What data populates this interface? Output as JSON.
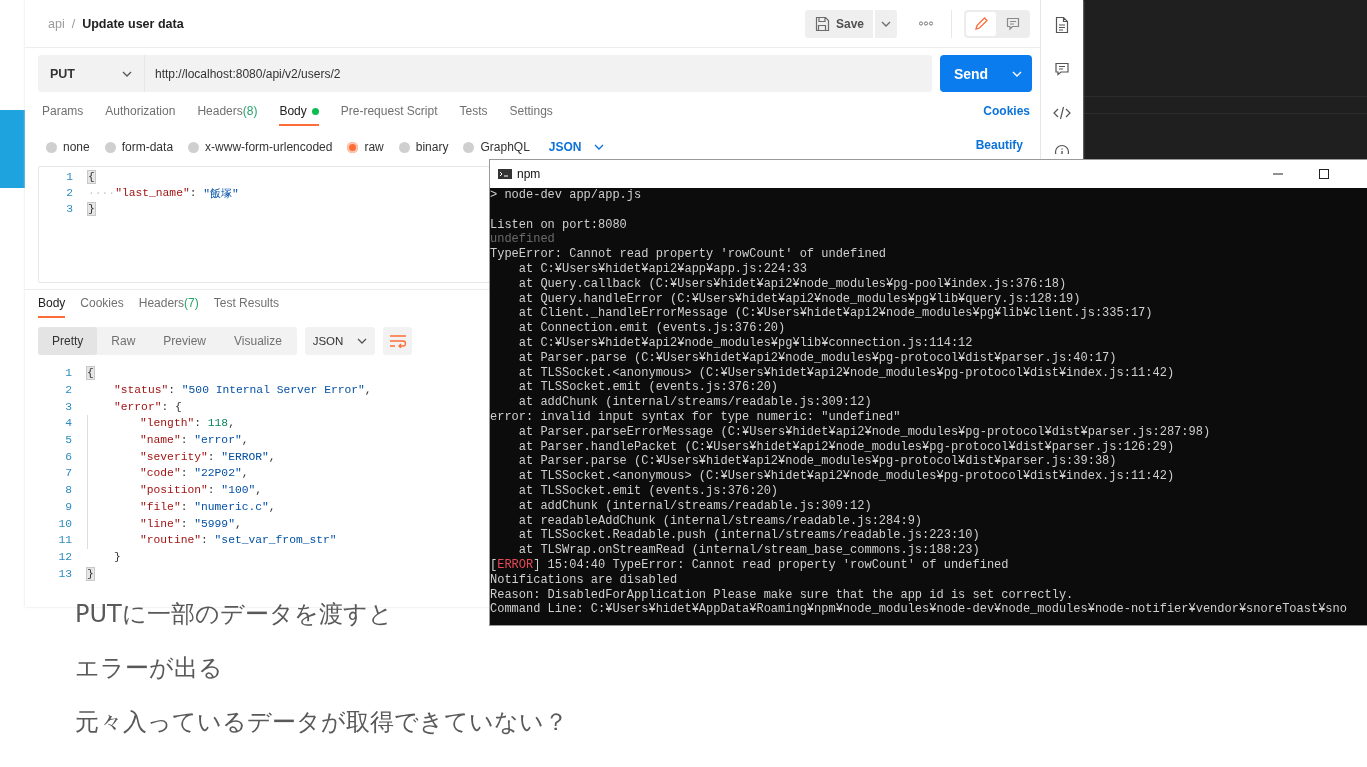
{
  "postman": {
    "breadcrumb": {
      "parent": "api",
      "separator": "/",
      "title": "Update user data"
    },
    "save": "Save",
    "mode_toggle": [
      {
        "selected": true
      },
      {
        "selected": false
      }
    ],
    "method": "PUT",
    "url": "http://localhost:8080/api/v2/users/2",
    "send": "Send",
    "request_tabs": [
      {
        "label": "Params",
        "selected": false
      },
      {
        "label": "Authorization",
        "selected": false
      },
      {
        "label": "Headers",
        "count": "(8)",
        "selected": false
      },
      {
        "label": "Body",
        "selected": true,
        "dot": true
      },
      {
        "label": "Pre-request Script",
        "selected": false
      },
      {
        "label": "Tests",
        "selected": false
      },
      {
        "label": "Settings",
        "selected": false
      }
    ],
    "cookies_link": "Cookies",
    "body_types": [
      {
        "label": "none",
        "selected": false
      },
      {
        "label": "form-data",
        "selected": false
      },
      {
        "label": "x-www-form-urlencoded",
        "selected": false
      },
      {
        "label": "raw",
        "selected": true
      },
      {
        "label": "binary",
        "selected": false
      },
      {
        "label": "GraphQL",
        "selected": false
      }
    ],
    "body_format": "JSON",
    "beautify": "Beautify",
    "request_body": [
      {
        "no": "1",
        "kind": "root",
        "tokens": [
          {
            "kind": "brace",
            "text": "{"
          }
        ]
      },
      {
        "no": "2",
        "kind": "root",
        "tokens": [
          {
            "kind": "ws",
            "text": "····"
          },
          {
            "kind": "key",
            "text": "\"last_name\""
          },
          {
            "kind": "punct",
            "text": ": "
          },
          {
            "kind": "string",
            "text": "\"飯塚\""
          }
        ]
      },
      {
        "no": "3",
        "kind": "root",
        "tokens": [
          {
            "kind": "brace",
            "text": "}"
          }
        ]
      }
    ],
    "response_tabs": [
      {
        "label": "Body",
        "selected": true
      },
      {
        "label": "Cookies",
        "selected": false
      },
      {
        "label": "Headers",
        "count": "(7)",
        "selected": false
      },
      {
        "label": "Test Results",
        "selected": false
      }
    ],
    "view_modes": [
      {
        "label": "Pretty",
        "selected": true
      },
      {
        "label": "Raw",
        "selected": false
      },
      {
        "label": "Preview",
        "selected": false
      },
      {
        "label": "Visualize",
        "selected": false
      }
    ],
    "response_format": "JSON",
    "response_body": [
      {
        "no": "1",
        "kind": "root",
        "tokens": [
          {
            "kind": "brace",
            "text": "{"
          }
        ]
      },
      {
        "no": "2",
        "kind": "member",
        "tokens": [
          {
            "kind": "key",
            "text": "\"status\""
          },
          {
            "kind": "punct",
            "text": ": "
          },
          {
            "kind": "string",
            "text": "\"500 Internal Server Error\""
          },
          {
            "kind": "punct",
            "text": ","
          }
        ]
      },
      {
        "no": "3",
        "kind": "member",
        "tokens": [
          {
            "kind": "key",
            "text": "\"error\""
          },
          {
            "kind": "punct",
            "text": ": {"
          }
        ]
      },
      {
        "no": "4",
        "kind": "inner",
        "tokens": [
          {
            "kind": "key",
            "text": "\"length\""
          },
          {
            "kind": "punct",
            "text": ": "
          },
          {
            "kind": "number",
            "text": "118"
          },
          {
            "kind": "punct",
            "text": ","
          }
        ]
      },
      {
        "no": "5",
        "kind": "inner",
        "tokens": [
          {
            "kind": "key",
            "text": "\"name\""
          },
          {
            "kind": "punct",
            "text": ": "
          },
          {
            "kind": "string",
            "text": "\"error\""
          },
          {
            "kind": "punct",
            "text": ","
          }
        ]
      },
      {
        "no": "6",
        "kind": "inner",
        "tokens": [
          {
            "kind": "key",
            "text": "\"severity\""
          },
          {
            "kind": "punct",
            "text": ": "
          },
          {
            "kind": "string",
            "text": "\"ERROR\""
          },
          {
            "kind": "punct",
            "text": ","
          }
        ]
      },
      {
        "no": "7",
        "kind": "inner",
        "tokens": [
          {
            "kind": "key",
            "text": "\"code\""
          },
          {
            "kind": "punct",
            "text": ": "
          },
          {
            "kind": "string",
            "text": "\"22P02\""
          },
          {
            "kind": "punct",
            "text": ","
          }
        ]
      },
      {
        "no": "8",
        "kind": "inner",
        "tokens": [
          {
            "kind": "key",
            "text": "\"position\""
          },
          {
            "kind": "punct",
            "text": ": "
          },
          {
            "kind": "string",
            "text": "\"100\""
          },
          {
            "kind": "punct",
            "text": ","
          }
        ]
      },
      {
        "no": "9",
        "kind": "inner",
        "tokens": [
          {
            "kind": "key",
            "text": "\"file\""
          },
          {
            "kind": "punct",
            "text": ": "
          },
          {
            "kind": "string",
            "text": "\"numeric.c\""
          },
          {
            "kind": "punct",
            "text": ","
          }
        ]
      },
      {
        "no": "10",
        "kind": "inner",
        "tokens": [
          {
            "kind": "key",
            "text": "\"line\""
          },
          {
            "kind": "punct",
            "text": ": "
          },
          {
            "kind": "string",
            "text": "\"5999\""
          },
          {
            "kind": "punct",
            "text": ","
          }
        ]
      },
      {
        "no": "11",
        "kind": "inner",
        "tokens": [
          {
            "kind": "key",
            "text": "\"routine\""
          },
          {
            "kind": "punct",
            "text": ": "
          },
          {
            "kind": "string",
            "text": "\"set_var_from_str\""
          }
        ]
      },
      {
        "no": "12",
        "kind": "member",
        "tokens": [
          {
            "kind": "punct",
            "text": "}"
          }
        ]
      },
      {
        "no": "13",
        "kind": "root",
        "tokens": [
          {
            "kind": "brace",
            "text": "}"
          }
        ]
      }
    ]
  },
  "terminal": {
    "title": "npm",
    "lines": [
      {
        "kind": "normal",
        "text": "> node-dev app/app.js"
      },
      {
        "kind": "blank"
      },
      {
        "kind": "normal",
        "text": "Listen on port:8080"
      },
      {
        "kind": "dim",
        "text": "undefined"
      },
      {
        "kind": "normal",
        "text": "TypeError: Cannot read property 'rowCount' of undefined"
      },
      {
        "kind": "normal",
        "text": "    at C:¥Users¥hidet¥api2¥app¥app.js:224:33"
      },
      {
        "kind": "normal",
        "text": "    at Query.callback (C:¥Users¥hidet¥api2¥node_modules¥pg-pool¥index.js:376:18)"
      },
      {
        "kind": "normal",
        "text": "    at Query.handleError (C:¥Users¥hidet¥api2¥node_modules¥pg¥lib¥query.js:128:19)"
      },
      {
        "kind": "normal",
        "text": "    at Client._handleErrorMessage (C:¥Users¥hidet¥api2¥node_modules¥pg¥lib¥client.js:335:17)"
      },
      {
        "kind": "normal",
        "text": "    at Connection.emit (events.js:376:20)"
      },
      {
        "kind": "normal",
        "text": "    at C:¥Users¥hidet¥api2¥node_modules¥pg¥lib¥connection.js:114:12"
      },
      {
        "kind": "normal",
        "text": "    at Parser.parse (C:¥Users¥hidet¥api2¥node_modules¥pg-protocol¥dist¥parser.js:40:17)"
      },
      {
        "kind": "normal",
        "text": "    at TLSSocket.<anonymous> (C:¥Users¥hidet¥api2¥node_modules¥pg-protocol¥dist¥index.js:11:42)"
      },
      {
        "kind": "normal",
        "text": "    at TLSSocket.emit (events.js:376:20)"
      },
      {
        "kind": "normal",
        "text": "    at addChunk (internal/streams/readable.js:309:12)"
      },
      {
        "kind": "normal",
        "text": "error: invalid input syntax for type numeric: \"undefined\""
      },
      {
        "kind": "normal",
        "text": "    at Parser.parseErrorMessage (C:¥Users¥hidet¥api2¥node_modules¥pg-protocol¥dist¥parser.js:287:98)"
      },
      {
        "kind": "normal",
        "text": "    at Parser.handlePacket (C:¥Users¥hidet¥api2¥node_modules¥pg-protocol¥dist¥parser.js:126:29)"
      },
      {
        "kind": "normal",
        "text": "    at Parser.parse (C:¥Users¥hidet¥api2¥node_modules¥pg-protocol¥dist¥parser.js:39:38)"
      },
      {
        "kind": "normal",
        "text": "    at TLSSocket.<anonymous> (C:¥Users¥hidet¥api2¥node_modules¥pg-protocol¥dist¥index.js:11:42)"
      },
      {
        "kind": "normal",
        "text": "    at TLSSocket.emit (events.js:376:20)"
      },
      {
        "kind": "normal",
        "text": "    at addChunk (internal/streams/readable.js:309:12)"
      },
      {
        "kind": "normal",
        "text": "    at readableAddChunk (internal/streams/readable.js:284:9)"
      },
      {
        "kind": "normal",
        "text": "    at TLSSocket.Readable.push (internal/streams/readable.js:223:10)"
      },
      {
        "kind": "normal",
        "text": "    at TLSWrap.onStreamRead (internal/stream_base_commons.js:188:23)"
      },
      {
        "kind": "tagged",
        "open": "[",
        "tag": "ERROR",
        "close": "]",
        "text": " 15:04:40 TypeError: Cannot read property 'rowCount' of undefined"
      },
      {
        "kind": "normal",
        "text": "Notifications are disabled"
      },
      {
        "kind": "normal",
        "text": "Reason: DisabledForApplication Please make sure that the app id is set correctly."
      },
      {
        "kind": "normal",
        "text": "Command Line: C:¥Users¥hidet¥AppData¥Roaming¥npm¥node_modules¥node-dev¥node_modules¥node-notifier¥vendor¥snoreToast¥sno"
      }
    ]
  },
  "slide_text": [
    "PUTに一部のデータを渡すと",
    "エラーが出る",
    "元々入っているデータが取得できていない？"
  ]
}
